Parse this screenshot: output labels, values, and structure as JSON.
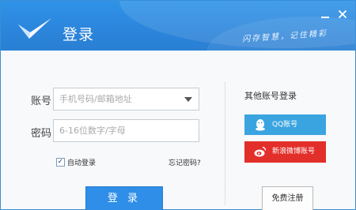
{
  "window": {
    "title": "登录",
    "slogan": "闪存智慧，记住精彩"
  },
  "form": {
    "account_label": "账号",
    "account_placeholder": "手机号码/邮箱地址",
    "password_label": "密码",
    "password_placeholder": "6-16位数字/字母",
    "auto_login_label": "自动登录",
    "auto_login_checked": true,
    "forgot_link": "忘记密码?",
    "login_button": "登 录"
  },
  "other_login": {
    "title": "其他账号登录",
    "qq_label": "QQ账号",
    "weibo_label": "新浪微博账号"
  },
  "register_button": "免费注册",
  "icons": {
    "logo": "checkmark-logo-icon",
    "minimize": "minimize-icon",
    "close": "close-icon",
    "dropdown": "dropdown-arrow-icon",
    "qq": "qq-penguin-icon",
    "weibo": "weibo-eye-icon"
  },
  "colors": {
    "header": "#2b86dc",
    "login_button": "#2e8ee8",
    "qq": "#3aa4e0",
    "weibo": "#e32f2a"
  }
}
